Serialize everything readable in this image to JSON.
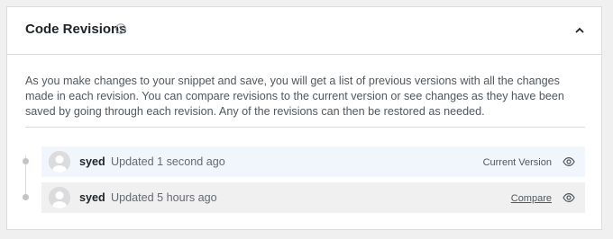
{
  "panel": {
    "title": "Code Revisions",
    "help_icon": "question-circle-icon",
    "collapse_icon": "chevron-up-icon",
    "description": "As you make changes to your snippet and save, you will get a list of previous versions with all the changes made in each revision. You can compare revisions to the current version or see changes as they have been saved by going through each revision. Any of the revisions can then be restored as needed."
  },
  "revisions": [
    {
      "author": "syed",
      "updated": "Updated 1 second ago",
      "status": "Current Version",
      "icon": "eye-icon"
    },
    {
      "author": "syed",
      "updated": "Updated 5 hours ago",
      "action": "Compare",
      "icon": "eye-icon"
    }
  ],
  "colors": {
    "current_row_bg": "#f0f6fc",
    "older_row_bg": "#f0f0f1",
    "border": "#dcdcde",
    "title_text": "#1d2327"
  }
}
